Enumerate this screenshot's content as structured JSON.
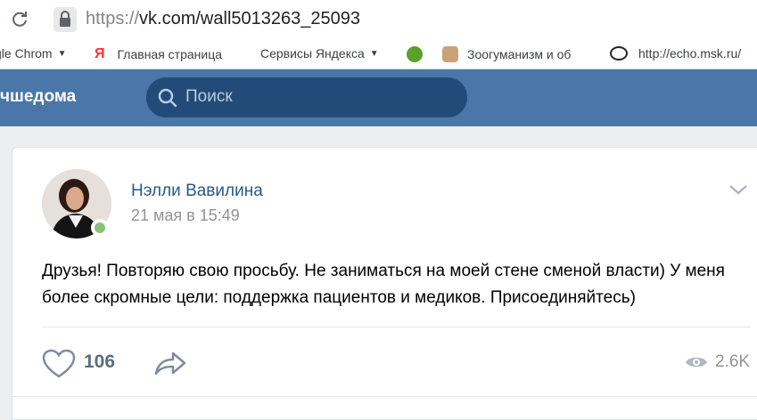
{
  "browser": {
    "url_scheme": "https://",
    "url_rest": "vk.com/wall5013263_25093"
  },
  "bookmarks": [
    {
      "label": "gle Chrom",
      "has_caret": true
    },
    {
      "label": "Главная страница",
      "has_caret": false
    },
    {
      "label": "Сервисы Яндекса",
      "has_caret": true
    },
    {
      "label": "Зоогуманизм и об",
      "has_caret": false
    },
    {
      "label": "http://echo.msk.ru/",
      "has_caret": false
    }
  ],
  "header": {
    "site_name": "чшедома",
    "search_placeholder": "Поиск"
  },
  "post": {
    "author": "Нэлли Вавилина",
    "date": "21 мая в 15:49",
    "text": "Друзья! Повторяю свою просьбу. Не заниматься на моей стене сменой власти) У меня более скромные цели: поддержка пациентов и медиков. Присоединяйтесь)",
    "likes": "106",
    "views": "2.6K"
  },
  "colors": {
    "header_bg": "#4a76a8",
    "search_bg": "#224b7a",
    "link": "#2a5885",
    "online": "#8ac176"
  }
}
